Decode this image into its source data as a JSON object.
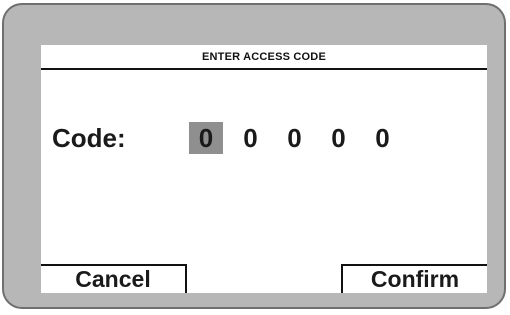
{
  "screen": {
    "title": "ENTER ACCESS CODE",
    "code_label": "Code:",
    "digits": [
      "0",
      "0",
      "0",
      "0",
      "0"
    ],
    "selected_digit_index": 0
  },
  "softkeys": {
    "left_label": "Cancel",
    "right_label": "Confirm"
  },
  "colors": {
    "bezel": "#b7b7b7",
    "screen_background": "#ffffff",
    "selected_digit_highlight": "#8f8f8f",
    "text": "#1a1a1a"
  }
}
